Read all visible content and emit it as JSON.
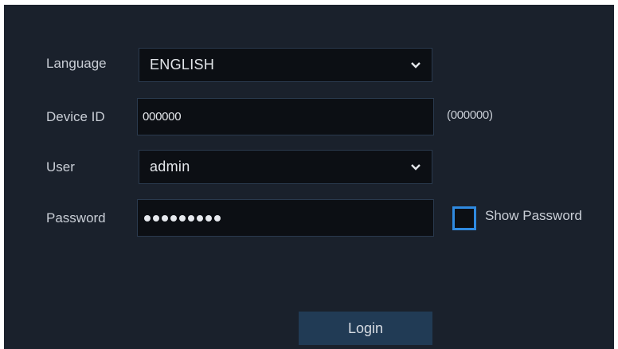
{
  "form": {
    "language": {
      "label": "Language",
      "value": "ENGLISH"
    },
    "device_id": {
      "label": "Device ID",
      "value": "000000",
      "hint": "(000000)"
    },
    "user": {
      "label": "User",
      "value": "admin"
    },
    "password": {
      "label": "Password",
      "masked_length": 9
    },
    "show_password": {
      "label": "Show Password",
      "checked": false
    },
    "login_label": "Login"
  },
  "icons": {
    "dropdown": "chevron-down-icon"
  },
  "colors": {
    "background": "#1a212c",
    "field_background": "#0c0f14",
    "field_border": "#2a3a4e",
    "checkbox_border": "#2f8ae0",
    "button_background": "#213b55"
  }
}
